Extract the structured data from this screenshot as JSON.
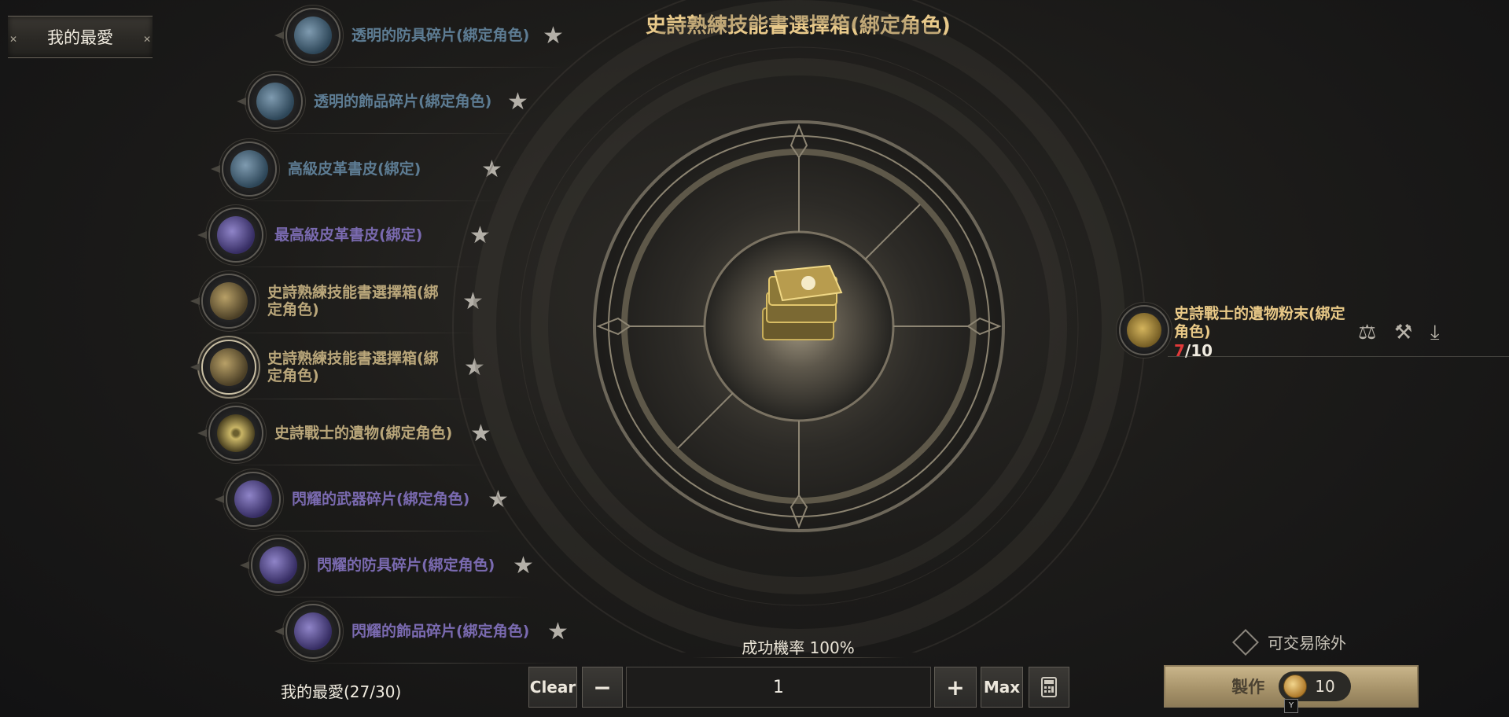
{
  "favorites_tab": {
    "label": "我的最愛"
  },
  "favorites_count": "我的最愛(27/30)",
  "title": "史詩熟練技能書選擇箱(綁定角色)",
  "recipes": [
    {
      "name": "透明的防具碎片(綁定角色)",
      "style": "blue",
      "icon": "armor-shard-icon"
    },
    {
      "name": "透明的飾品碎片(綁定角色)",
      "style": "blue",
      "icon": "accessory-shard-icon"
    },
    {
      "name": "高級皮革書皮(綁定)",
      "style": "blue",
      "icon": "leather-cover-icon"
    },
    {
      "name": "最高級皮革書皮(綁定)",
      "style": "violet",
      "icon": "leather-cover-icon"
    },
    {
      "name": "史詩熟練技能書選擇箱(綁定角色)",
      "style": "gold",
      "icon": "skill-book-box-icon"
    },
    {
      "name": "史詩熟練技能書選擇箱(綁定角色)",
      "style": "gold",
      "icon": "skill-book-box-icon",
      "selected": true
    },
    {
      "name": "史詩戰士的遺物(綁定角色)",
      "style": "gold",
      "icon": "warrior-relic-icon"
    },
    {
      "name": "閃耀的武器碎片(綁定角色)",
      "style": "violet",
      "icon": "weapon-shard-icon"
    },
    {
      "name": "閃耀的防具碎片(綁定角色)",
      "style": "violet",
      "icon": "armor-shard-icon"
    },
    {
      "name": "閃耀的飾品碎片(綁定角色)",
      "style": "violet",
      "icon": "accessory-shard-icon"
    }
  ],
  "result_item": {
    "icon": "skill-book-stack-icon"
  },
  "success_rate": "成功機率 100%",
  "controls": {
    "clear": "Clear",
    "minus": "−",
    "quantity": "1",
    "plus": "+",
    "max": "Max",
    "calculator_icon": "calculator-icon"
  },
  "material": {
    "name": "史詩戰士的遺物粉末(綁定角色)",
    "have": "7",
    "need": "/10",
    "icons": [
      "scale-icon",
      "hammer-icon",
      "hand-receive-icon"
    ]
  },
  "exclude_tradable": "可交易除外",
  "craft": {
    "label": "製作",
    "cost": "10",
    "hotkey": "Y"
  },
  "colors": {
    "title": "#e8c98a",
    "insufficient": "#e23a3a",
    "craft_button": "#b9a57a"
  }
}
